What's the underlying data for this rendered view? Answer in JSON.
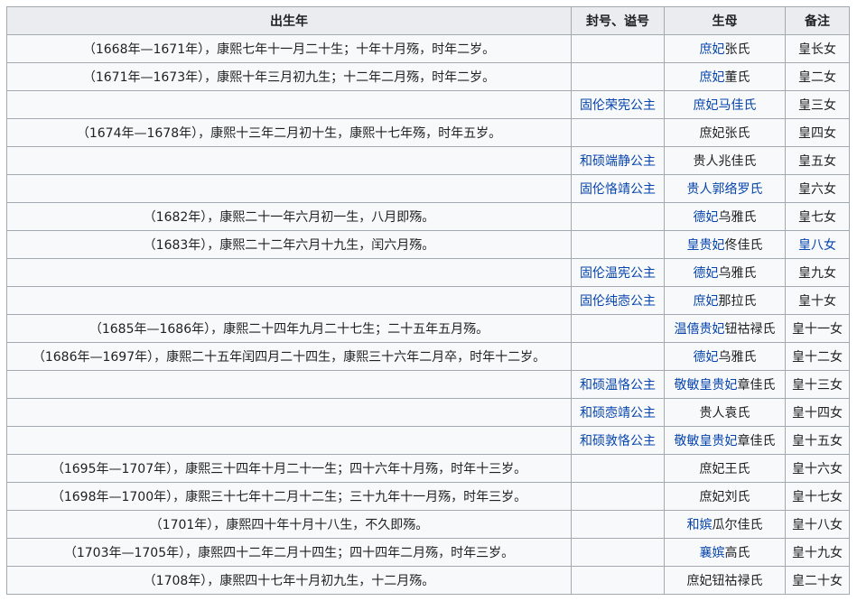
{
  "table": {
    "headers": [
      "出生年",
      "封号、谥号",
      "生母",
      "备注"
    ],
    "rows": [
      {
        "birth": "（1668年—1671年），康熙七年十一月二十生；十年十月殇，时年二岁。",
        "title": "",
        "mother_link": "庶妃",
        "mother_rest": "张氏",
        "note": "皇长女"
      },
      {
        "birth": "（1671年—1673年），康熙十年三月初九生；十二年二月殇，时年二岁。",
        "title": "",
        "mother_link": "庶妃",
        "mother_rest": "董氏",
        "note": "皇二女"
      },
      {
        "birth": "",
        "title": "固伦荣宪公主",
        "mother_link": "庶妃马佳氏",
        "mother_rest": "",
        "note": "皇三女"
      },
      {
        "birth": "（1674年—1678年），康熙十三年二月初十生，康熙十七年殇，时年五岁。",
        "title": "",
        "mother_link": "",
        "mother_rest": "庶妃张氏",
        "note": "皇四女"
      },
      {
        "birth": "",
        "title": "和硕端静公主",
        "mother_link": "",
        "mother_rest": "贵人兆佳氏",
        "note": "皇五女"
      },
      {
        "birth": "",
        "title": "固伦恪靖公主",
        "mother_link": "贵人郭络罗氏",
        "mother_rest": "",
        "note": "皇六女"
      },
      {
        "birth": "（1682年），康熙二十一年六月初一生，八月即殇。",
        "title": "",
        "mother_link": "德妃",
        "mother_rest": "乌雅氏",
        "note": "皇七女"
      },
      {
        "birth": "（1683年），康熙二十二年六月十九生，闰六月殇。",
        "title": "",
        "mother_link": "皇贵妃",
        "mother_rest": "佟佳氏",
        "note": "皇八女",
        "note_link": true
      },
      {
        "birth": "",
        "title": "固伦温宪公主",
        "mother_link": "德妃",
        "mother_rest": "乌雅氏",
        "note": "皇九女"
      },
      {
        "birth": "",
        "title": "固伦纯悫公主",
        "mother_link": "庶妃",
        "mother_rest": "那拉氏",
        "note": "皇十女"
      },
      {
        "birth": "（1685年—1686年），康熙二十四年九月二十七生；二十五年五月殇。",
        "title": "",
        "mother_link": "温僖贵妃",
        "mother_rest": "钮祜禄氏",
        "note": "皇十一女"
      },
      {
        "birth": "（1686年—1697年），康熙二十五年闰四月二十四生，康熙三十六年二月卒，时年十二岁。",
        "title": "",
        "mother_link": "德妃",
        "mother_rest": "乌雅氏",
        "note": "皇十二女"
      },
      {
        "birth": "",
        "title": "和硕温恪公主",
        "mother_link": "敬敏皇贵妃",
        "mother_rest": "章佳氏",
        "note": "皇十三女"
      },
      {
        "birth": "",
        "title": "和硕悫靖公主",
        "mother_link": "",
        "mother_rest": "贵人袁氏",
        "note": "皇十四女"
      },
      {
        "birth": "",
        "title": "和硕敦恪公主",
        "mother_link": "敬敏皇贵妃",
        "mother_rest": "章佳氏",
        "note": "皇十五女"
      },
      {
        "birth": "（1695年—1707年），康熙三十四年十月二十一生；四十六年十月殇，时年十三岁。",
        "title": "",
        "mother_link": "",
        "mother_rest": "庶妃王氏",
        "note": "皇十六女"
      },
      {
        "birth": "（1698年—1700年），康熙三十七年十二月十二生；三十九年十一月殇，时年三岁。",
        "title": "",
        "mother_link": "",
        "mother_rest": "庶妃刘氏",
        "note": "皇十七女"
      },
      {
        "birth": "（1701年），康熙四十年十月十八生，不久即殇。",
        "title": "",
        "mother_link": "和嫔",
        "mother_rest": "瓜尔佳氏",
        "note": "皇十八女"
      },
      {
        "birth": "（1703年—1705年），康熙四十二年二月十四生；四十四年二月殇，时年三岁。",
        "title": "",
        "mother_link": "襄嫔",
        "mother_rest": "高氏",
        "note": "皇十九女"
      },
      {
        "birth": "（1708年），康熙四十七年十月初九生，十二月殇。",
        "title": "",
        "mother_link": "",
        "mother_rest": "庶妃钮祜禄氏",
        "note": "皇二十女"
      }
    ]
  }
}
